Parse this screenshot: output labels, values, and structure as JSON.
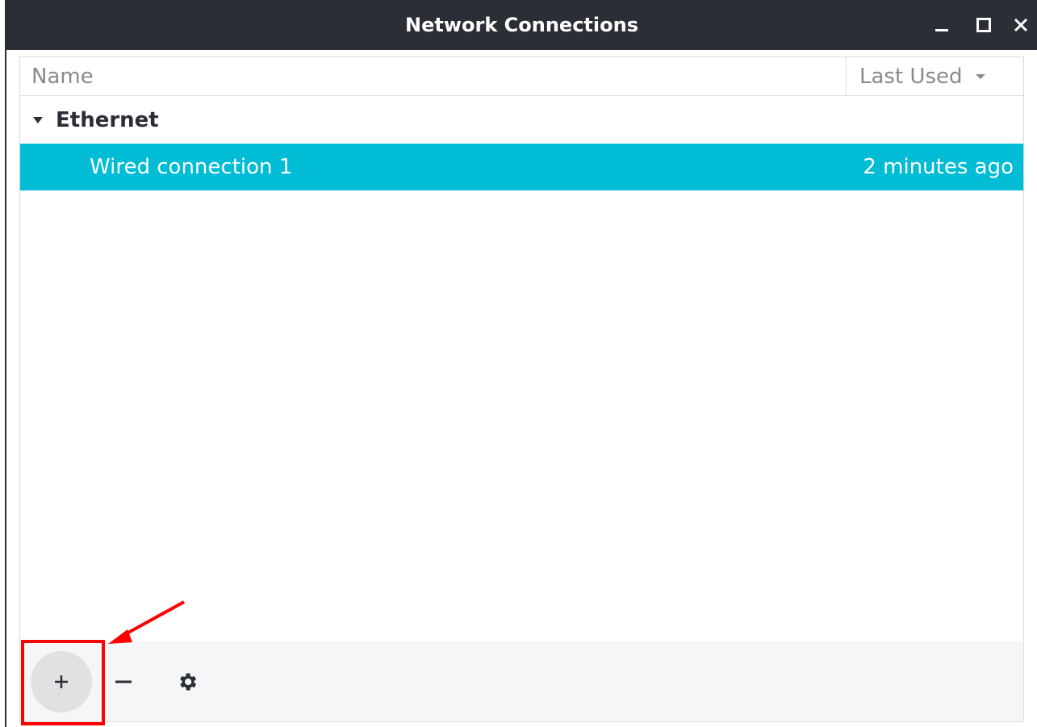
{
  "window": {
    "title": "Network Connections",
    "controls": [
      "minimize-icon",
      "maximize-icon",
      "close-icon"
    ]
  },
  "list": {
    "columns": {
      "name": "Name",
      "last_used": "Last Used"
    },
    "groups": [
      {
        "label": "Ethernet",
        "expanded": true,
        "connections": [
          {
            "name": "Wired connection 1",
            "last_used": "2 minutes ago",
            "selected": true
          }
        ]
      }
    ]
  },
  "toolbar": {
    "buttons": [
      "add-icon",
      "remove-icon",
      "gear-icon"
    ]
  },
  "colors": {
    "titlebar": "#2b2e37",
    "selection": "#00bcd4",
    "annotation": "#ff0000"
  }
}
